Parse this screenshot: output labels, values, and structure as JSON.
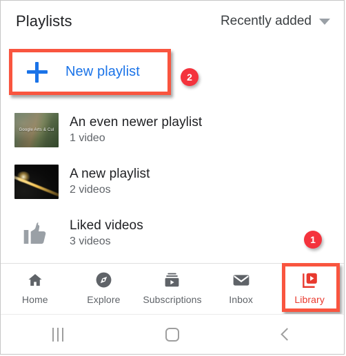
{
  "header": {
    "title": "Playlists",
    "sort_label": "Recently added",
    "sort_caret_icon": "chevron-down-icon"
  },
  "new_playlist": {
    "label": "New playlist",
    "plus_icon": "plus-icon",
    "accent_color": "#1a73e8"
  },
  "annotations": {
    "highlight_color": "#f9553f",
    "badge_color": "#f4333d",
    "badge_library": "1",
    "badge_new_playlist": "2"
  },
  "playlists": [
    {
      "name": "An even newer playlist",
      "count": "1 video",
      "thumb_type": "canyon-photo",
      "thumb_watermark": "Google Arts & Cul"
    },
    {
      "name": "A new playlist",
      "count": "2 videos",
      "thumb_type": "comet-photo",
      "thumb_watermark": ""
    },
    {
      "name": "Liked videos",
      "count": "3 videos",
      "thumb_type": "thumbs-up-icon",
      "thumb_watermark": ""
    }
  ],
  "tabbar": {
    "items": [
      {
        "label": "Home",
        "icon": "home-icon",
        "active": false
      },
      {
        "label": "Explore",
        "icon": "compass-icon",
        "active": false
      },
      {
        "label": "Subscriptions",
        "icon": "subscriptions-icon",
        "active": false
      },
      {
        "label": "Inbox",
        "icon": "envelope-icon",
        "active": false
      },
      {
        "label": "Library",
        "icon": "library-icon",
        "active": true
      }
    ],
    "active_color": "#e8392e",
    "inactive_color": "#5f6368"
  },
  "system_nav": {
    "recents_icon": "recents-icon",
    "home_icon": "home-square-icon",
    "back_icon": "back-chevron-icon"
  }
}
